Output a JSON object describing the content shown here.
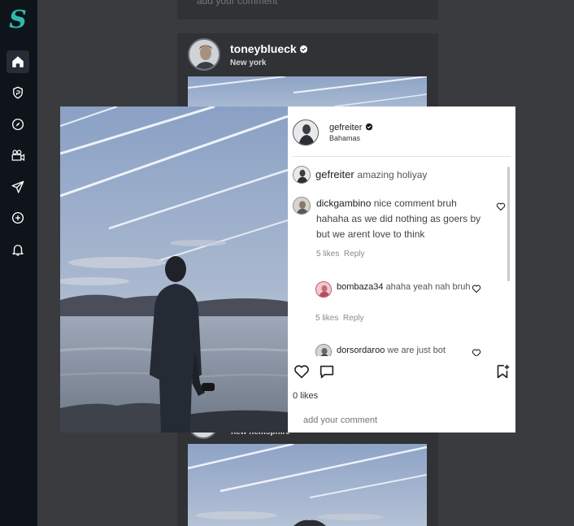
{
  "sidebar": {
    "logo": "S",
    "items": [
      {
        "name": "home",
        "active": true
      },
      {
        "name": "shield"
      },
      {
        "name": "explore"
      },
      {
        "name": "reels"
      },
      {
        "name": "send"
      },
      {
        "name": "create"
      },
      {
        "name": "notifications"
      }
    ]
  },
  "feed": {
    "top_comment_placeholder": "add your comment",
    "post": {
      "username": "toneyblueck",
      "location": "New york"
    },
    "next_post_location": "new hemsphire"
  },
  "modal": {
    "author": {
      "username": "gefreiter",
      "location": "Bahamas"
    },
    "caption": {
      "username": "gefreiter",
      "text": "amazing holiyay"
    },
    "comments": [
      {
        "username": "dickgambino",
        "text": "nice comment bruh hahaha as we did nothing as goers by but we arent love to think",
        "likes": "5 likes",
        "reply": "Reply"
      },
      {
        "username": "bombaza34",
        "text": "ahaha yeah nah bruh",
        "likes": "5 likes",
        "reply": "Reply"
      },
      {
        "username": "dorsordaroo",
        "text": "we are just bot"
      }
    ],
    "likes_count": "0 likes",
    "comment_placeholder": "add your comment"
  },
  "colors": {
    "sidebar_bg": "#0f141b",
    "page_bg": "#3a3b3e",
    "accent": "#31b9ad"
  }
}
